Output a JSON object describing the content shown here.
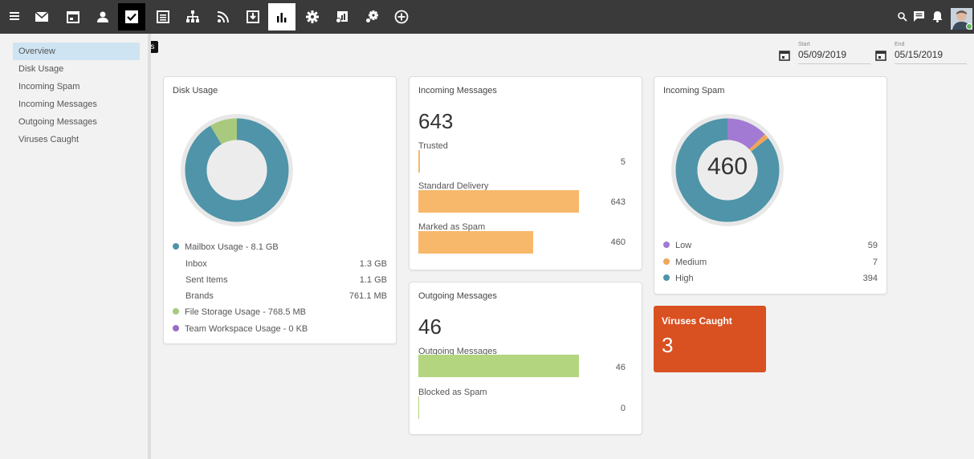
{
  "tooltip": "Tasks",
  "toolbar": {
    "icons": [
      "menu-icon",
      "mail-icon",
      "calendar-icon",
      "contacts-icon",
      "tasks-icon",
      "notes-icon",
      "org-chart-icon",
      "rss-icon",
      "archive-icon",
      "reports-icon",
      "settings-icon",
      "analytics-icon",
      "admin-settings-icon",
      "add-icon"
    ],
    "right_icons": [
      "search-icon",
      "chat-icon",
      "bell-icon",
      "avatar"
    ]
  },
  "sidebar": {
    "items": [
      {
        "label": "Overview",
        "selected": true
      },
      {
        "label": "Disk Usage"
      },
      {
        "label": "Incoming Spam"
      },
      {
        "label": "Incoming Messages"
      },
      {
        "label": "Outgoing Messages"
      },
      {
        "label": "Viruses Caught"
      }
    ]
  },
  "date_range": {
    "start_label": "Start",
    "start_value": "05/09/2019",
    "end_label": "End",
    "end_value": "05/15/2019"
  },
  "disk_usage": {
    "title": "Disk Usage",
    "legend": [
      {
        "label": "Mailbox Usage - 8.1 GB",
        "color": "#4f94a8"
      },
      {
        "label": "File Storage Usage - 768.5 MB",
        "color": "#a9c97e"
      },
      {
        "label": "Team Workspace Usage - 0 KB",
        "color": "#9b6cc4"
      }
    ],
    "sub_items": [
      {
        "label": "Inbox",
        "value": "1.3 GB"
      },
      {
        "label": "Sent Items",
        "value": "1.1 GB"
      },
      {
        "label": "Brands",
        "value": "761.1 MB"
      }
    ],
    "chart": {
      "mailbox_fraction": 0.913,
      "file_fraction": 0.087
    }
  },
  "incoming_messages": {
    "title": "Incoming Messages",
    "total": "643",
    "bars": [
      {
        "label": "Trusted",
        "value": "5",
        "fraction": 0.008
      },
      {
        "label": "Standard Delivery",
        "value": "643",
        "fraction": 1.0
      },
      {
        "label": "Marked as Spam",
        "value": "460",
        "fraction": 0.715
      }
    ],
    "color": "#f7b86b"
  },
  "outgoing_messages": {
    "title": "Outgoing Messages",
    "total": "46",
    "bars": [
      {
        "label": "Outgoing Messages",
        "value": "46",
        "fraction": 1.0
      },
      {
        "label": "Blocked as Spam",
        "value": "0",
        "fraction": 0.0
      }
    ],
    "color": "#b3d57f"
  },
  "incoming_spam": {
    "title": "Incoming Spam",
    "total": "460",
    "legend": [
      {
        "label": "Low",
        "value": "59",
        "color": "#a27ad4"
      },
      {
        "label": "Medium",
        "value": "7",
        "color": "#f0a65a"
      },
      {
        "label": "High",
        "value": "394",
        "color": "#4f94a8"
      }
    ]
  },
  "viruses": {
    "title": "Viruses Caught",
    "count": "3",
    "color": "#d95021"
  }
}
